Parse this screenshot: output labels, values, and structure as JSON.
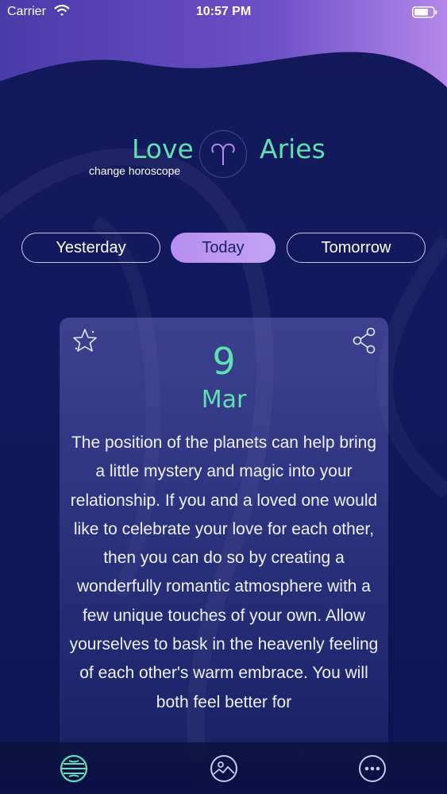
{
  "status_bar": {
    "carrier": "Carrier",
    "time": "10:57 PM"
  },
  "header": {
    "category": "Love",
    "sign": "Aries",
    "change_label": "change horoscope",
    "sign_icon": "aries-icon"
  },
  "tabs": [
    {
      "label": "Yesterday",
      "selected": false
    },
    {
      "label": "Today",
      "selected": true
    },
    {
      "label": "Tomorrow",
      "selected": false
    }
  ],
  "card": {
    "day": "9",
    "month": "Mar",
    "text": "The position of the planets can help bring a little mystery and magic into your relationship. If you and a loved one would like to celebrate your love for each other, then you can do so by creating a wonderfully romantic atmosphere with a few unique touches of your own. Allow yourselves to bask in the heavenly feeling of each other's warm embrace. You will both feel better for",
    "favorite_icon": "star-icon",
    "share_icon": "share-icon"
  },
  "bottom_nav": [
    {
      "icon": "horoscope-globe-icon",
      "active": true
    },
    {
      "icon": "image-icon",
      "active": false
    },
    {
      "icon": "more-icon",
      "active": false
    }
  ],
  "colors": {
    "accent": "#5fe0b0",
    "tab_selected": "#b78ef0",
    "background": "#111a5e"
  }
}
